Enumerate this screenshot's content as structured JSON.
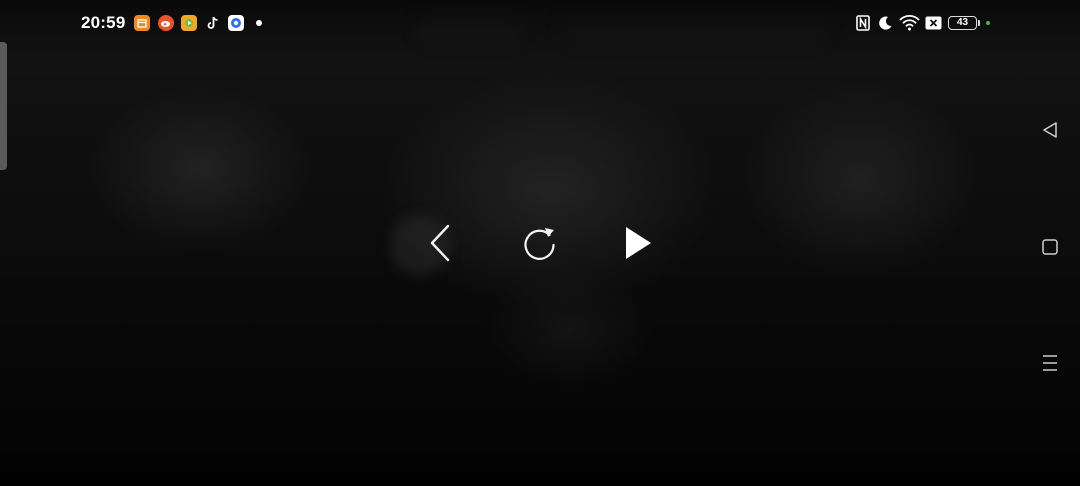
{
  "status_bar": {
    "time": "20:59",
    "battery_level": "43",
    "notification_icons": [
      "calendar-app-icon",
      "weibo-app-icon",
      "video-app-icon",
      "tiktok-app-icon",
      "browser-app-icon"
    ],
    "system_icons": [
      "nfc-icon",
      "moon-icon",
      "wifi-icon",
      "sim-off-icon",
      "battery-icon"
    ],
    "colors": {
      "calendar": "#f08a1c",
      "weibo": "#e8532a",
      "video": "#f5a623",
      "browser": "#2e6ef0",
      "charge": "#2bbf4e"
    }
  },
  "player": {
    "controls": [
      "previous-icon",
      "replay-icon",
      "play-icon"
    ]
  },
  "navigation_bar": {
    "buttons": [
      "back-icon",
      "home-icon",
      "menu-icon"
    ]
  }
}
